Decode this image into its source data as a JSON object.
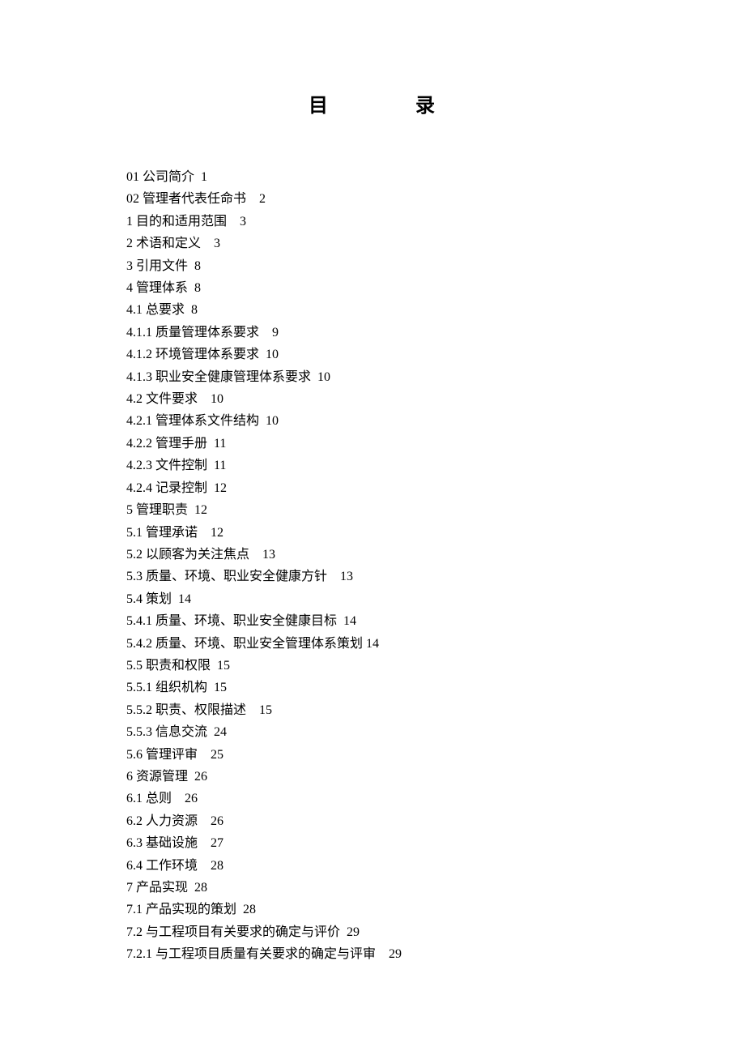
{
  "title": {
    "char1": "目",
    "char2": "录"
  },
  "toc": [
    {
      "label": "01 公司简介",
      "page": "1",
      "gap": "  "
    },
    {
      "label": "02 管理者代表任命书",
      "page": "2",
      "gap": "    "
    },
    {
      "label": "1 目的和适用范围",
      "page": "3",
      "gap": "    "
    },
    {
      "label": "2 术语和定义",
      "page": "3",
      "gap": "    "
    },
    {
      "label": "3 引用文件",
      "page": "8",
      "gap": "  "
    },
    {
      "label": "4 管理体系",
      "page": "8",
      "gap": "  "
    },
    {
      "label": "4.1 总要求",
      "page": "8",
      "gap": "  "
    },
    {
      "label": "4.1.1 质量管理体系要求",
      "page": "9",
      "gap": "    "
    },
    {
      "label": "4.1.2 环境管理体系要求",
      "page": "10",
      "gap": "  "
    },
    {
      "label": "4.1.3 职业安全健康管理体系要求",
      "page": "10",
      "gap": "  "
    },
    {
      "label": "4.2 文件要求",
      "page": "10",
      "gap": "    "
    },
    {
      "label": "4.2.1 管理体系文件结构",
      "page": "10",
      "gap": "  "
    },
    {
      "label": "4.2.2 管理手册",
      "page": "11",
      "gap": "  "
    },
    {
      "label": "4.2.3 文件控制",
      "page": "11",
      "gap": "  "
    },
    {
      "label": "4.2.4 记录控制",
      "page": "12",
      "gap": "  "
    },
    {
      "label": "5 管理职责",
      "page": "12",
      "gap": "  "
    },
    {
      "label": "5.1 管理承诺",
      "page": "12",
      "gap": "    "
    },
    {
      "label": "5.2 以顾客为关注焦点",
      "page": "13",
      "gap": "    "
    },
    {
      "label": "5.3 质量、环境、职业安全健康方针",
      "page": "13",
      "gap": "    "
    },
    {
      "label": "5.4 策划",
      "page": "14",
      "gap": "  "
    },
    {
      "label": "5.4.1 质量、环境、职业安全健康目标",
      "page": "14",
      "gap": "  "
    },
    {
      "label": "5.4.2 质量、环境、职业安全管理体系策划",
      "page": "14",
      "gap": " "
    },
    {
      "label": "5.5 职责和权限",
      "page": "15",
      "gap": "  "
    },
    {
      "label": "5.5.1 组织机构",
      "page": "15",
      "gap": "  "
    },
    {
      "label": "5.5.2 职责、权限描述",
      "page": "15",
      "gap": "    "
    },
    {
      "label": "5.5.3 信息交流",
      "page": "24",
      "gap": "  "
    },
    {
      "label": "5.6 管理评审",
      "page": "25",
      "gap": "    "
    },
    {
      "label": "6 资源管理",
      "page": "26",
      "gap": "  "
    },
    {
      "label": "6.1 总则",
      "page": "26",
      "gap": "    "
    },
    {
      "label": "6.2 人力资源",
      "page": "26",
      "gap": "    "
    },
    {
      "label": "6.3 基础设施",
      "page": "27",
      "gap": "    "
    },
    {
      "label": "6.4 工作环境",
      "page": "28",
      "gap": "    "
    },
    {
      "label": "7 产品实现",
      "page": "28",
      "gap": "  "
    },
    {
      "label": "7.1 产品实现的策划",
      "page": "28",
      "gap": "  "
    },
    {
      "label": "7.2 与工程项目有关要求的确定与评价",
      "page": "29",
      "gap": "  "
    },
    {
      "label": "7.2.1 与工程项目质量有关要求的确定与评审",
      "page": "29",
      "gap": "    "
    }
  ]
}
